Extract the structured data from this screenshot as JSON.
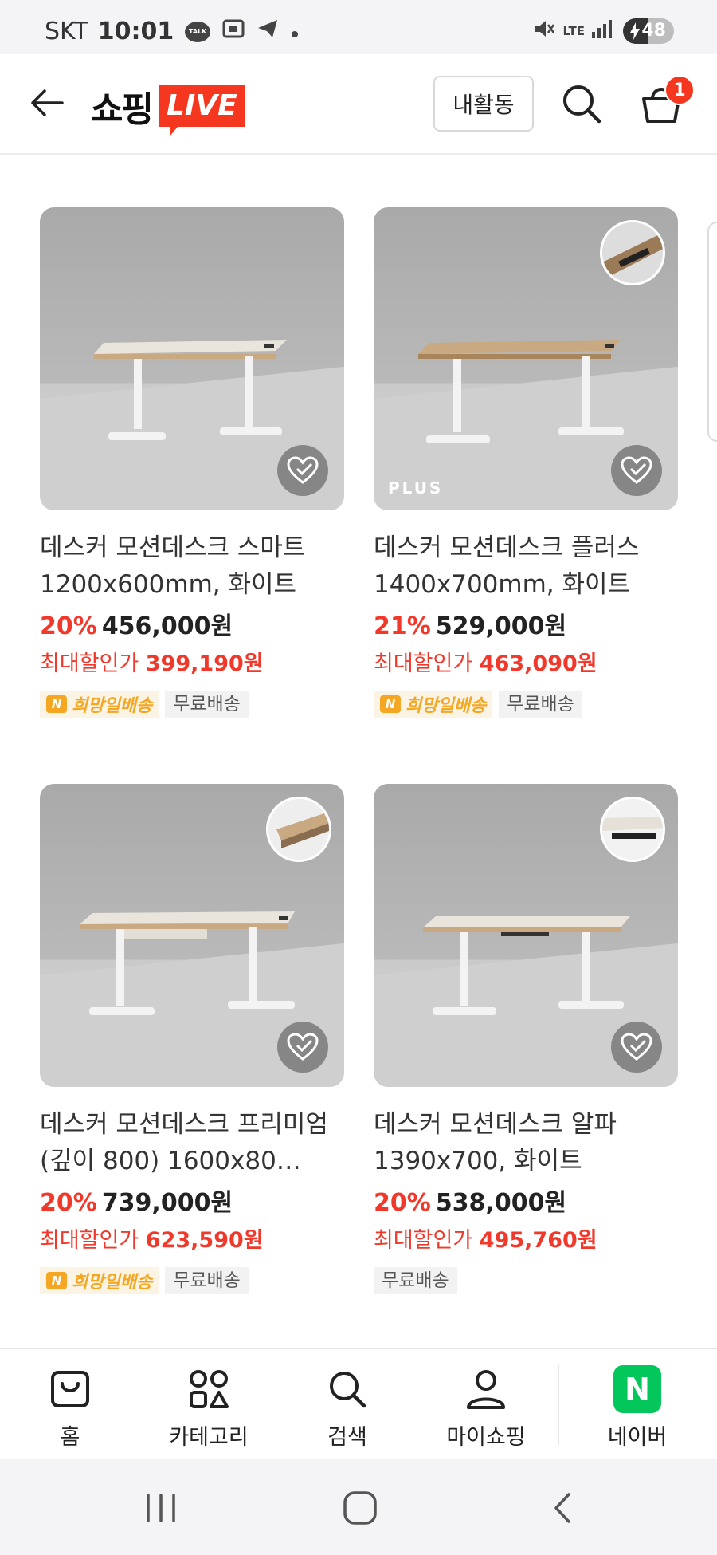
{
  "status_bar": {
    "carrier": "SKT",
    "time": "10:01",
    "talk_icon_text": "TALK",
    "network": "LTE",
    "battery_level": "48",
    "battery_fraction": 0.48
  },
  "header": {
    "logo_text": "쇼핑",
    "logo_live": "LIVE",
    "activity_label": "내활동",
    "cart_count": "1"
  },
  "products": [
    {
      "title": "데스커 모션데스크 스마트 1200x600mm, 화이트",
      "discount": "20%",
      "price": "456,000원",
      "max_label": "최대할인가",
      "max_price": "399,190원",
      "hope_delivery": "희망일배송",
      "free_shipping": "무료배송",
      "badge": ""
    },
    {
      "title": "데스커 모션데스크 플러스 1400x700mm, 화이트",
      "discount": "21%",
      "price": "529,000원",
      "max_label": "최대할인가",
      "max_price": "463,090원",
      "hope_delivery": "희망일배송",
      "free_shipping": "무료배송",
      "badge": "PLUS"
    },
    {
      "title": "데스커 모션데스크 프리미엄 (깊이 800) 1600x80…",
      "discount": "20%",
      "price": "739,000원",
      "max_label": "최대할인가",
      "max_price": "623,590원",
      "hope_delivery": "희망일배송",
      "free_shipping": "무료배송",
      "badge": ""
    },
    {
      "title": "데스커 모션데스크 알파 1390x700, 화이트",
      "discount": "20%",
      "price": "538,000원",
      "max_label": "최대할인가",
      "max_price": "495,760원",
      "free_shipping": "무료배송",
      "badge": ""
    }
  ],
  "bottom_nav": {
    "home": "홈",
    "category": "카테고리",
    "search": "검색",
    "my_shopping": "마이쇼핑",
    "naver": "네이버",
    "naver_logo": "N"
  },
  "icons": {
    "back": "arrow-left-icon",
    "search": "search-icon",
    "cart": "cart-icon",
    "wishlist": "heart-check-icon",
    "home": "shopping-bag-icon",
    "category": "grid-shapes-icon",
    "person": "person-icon",
    "recent_apps": "recent-apps-icon",
    "home_button": "home-square-icon",
    "back_button": "chevron-left-icon"
  },
  "colors": {
    "accent": "#f5371f",
    "discount": "#f0392b",
    "naver_green": "#03c75a",
    "hope_delivery": "#f5a623"
  }
}
